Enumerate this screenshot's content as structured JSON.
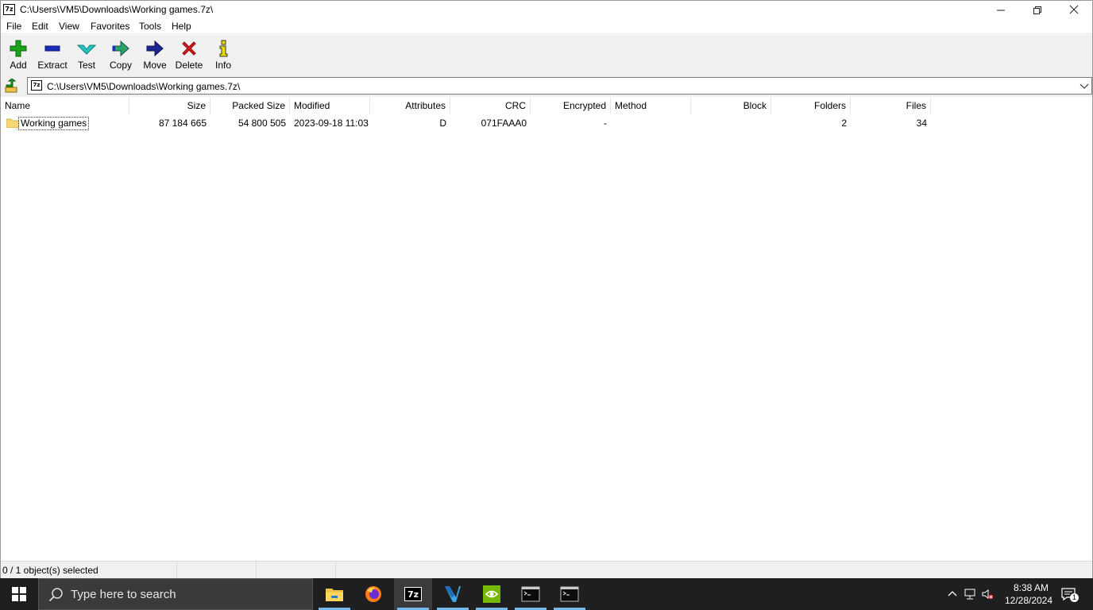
{
  "window": {
    "title": "C:\\Users\\VM5\\Downloads\\Working games.7z\\",
    "app_icon_text": "7z"
  },
  "menu": [
    "File",
    "Edit",
    "View",
    "Favorites",
    "Tools",
    "Help"
  ],
  "toolbar": {
    "add": "Add",
    "extract": "Extract",
    "test": "Test",
    "copy": "Copy",
    "move": "Move",
    "delete": "Delete",
    "info": "Info"
  },
  "address": {
    "path": "C:\\Users\\VM5\\Downloads\\Working games.7z\\"
  },
  "columns": {
    "name": "Name",
    "size": "Size",
    "packed_size": "Packed Size",
    "modified": "Modified",
    "attributes": "Attributes",
    "crc": "CRC",
    "encrypted": "Encrypted",
    "method": "Method",
    "block": "Block",
    "folders": "Folders",
    "files": "Files"
  },
  "rows": [
    {
      "name": "Working games",
      "size": "87 184 665",
      "packed_size": "54 800 505",
      "modified": "2023-09-18 11:03",
      "attributes": "D",
      "crc": "071FAAA0",
      "encrypted": "-",
      "method": "",
      "block": "",
      "folders": "2",
      "files": "34"
    }
  ],
  "status": {
    "selection": "0 / 1 object(s) selected"
  },
  "taskbar": {
    "search_placeholder": "Type here to search",
    "apps": [
      "file-explorer",
      "firefox",
      "7-zip",
      "visual-studio",
      "nvidia",
      "terminal",
      "terminal"
    ],
    "clock_time": "8:38 AM",
    "clock_date": "12/28/2024",
    "notification_count": "1"
  },
  "colors": {
    "taskbar_bg": "#1f1f1f",
    "toolbar_bg": "#f0f0f0",
    "active_underline": "#76b9ed",
    "folder": "#f7d774"
  }
}
